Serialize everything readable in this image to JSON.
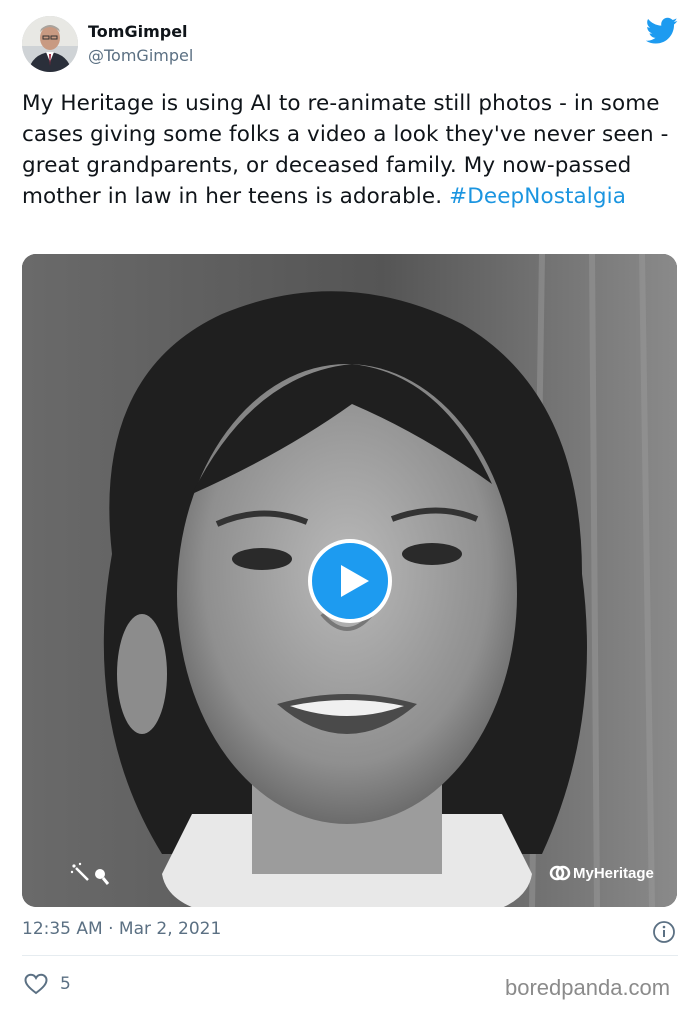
{
  "author": {
    "display_name": "TomGimpel",
    "handle": "@TomGimpel",
    "avatar_icon": "profile-photo"
  },
  "tweet": {
    "text": "My Heritage is using AI to re-animate still photos - in some cases giving some folks a video a look they've never seen - great grandparents, or deceased family. My now-passed mother in law in her teens is adorable. ",
    "hashtag": "#DeepNostalgia"
  },
  "media": {
    "watermark": "MyHeritage",
    "play_icon": "play-icon",
    "tool_icon": "magic-wand-icon"
  },
  "meta": {
    "timestamp": "12:35 AM · Mar 2, 2021",
    "like_count": "5"
  },
  "source": "boredpanda.com",
  "colors": {
    "accent": "#1d9bf0",
    "hashtag": "#1b95e0",
    "muted": "#5b7083"
  }
}
